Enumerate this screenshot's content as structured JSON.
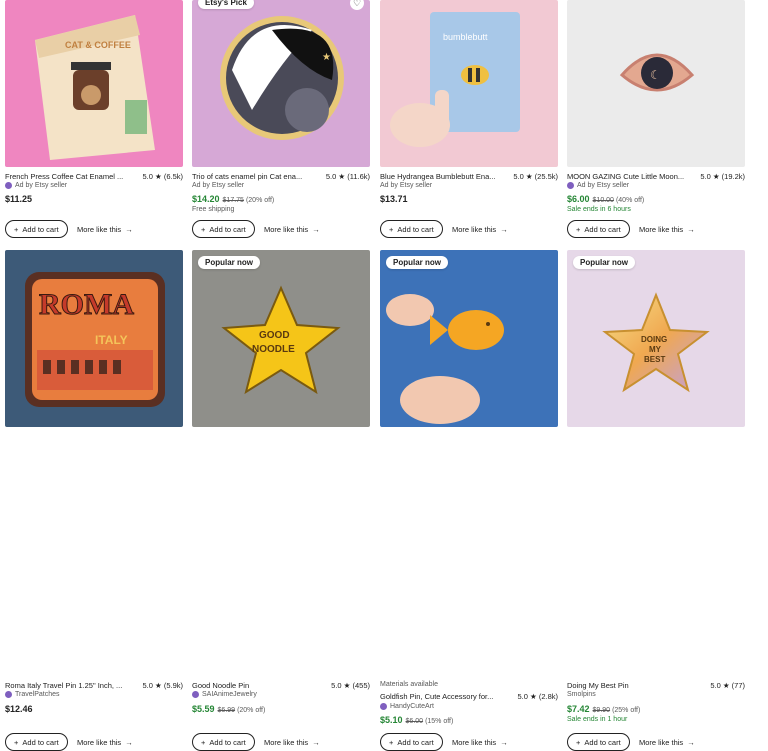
{
  "common": {
    "add_to_cart": "Add to cart",
    "more_like_this": "More like this",
    "plus_glyph": "+",
    "arrow_glyph": "→",
    "heart_glyph": "♡"
  },
  "items": [
    {
      "badge": "",
      "title": "French Press Coffee Cat Enamel ...",
      "rating": "5.0 ★ (6.5k)",
      "seller": "Ad by Etsy seller",
      "seller_badge": true,
      "price": "$11.25",
      "orig": "",
      "off": "",
      "sale": false,
      "extra": "",
      "image": "cat & coffee enamel pin on pink card",
      "img_text": "CAT & COFFEE"
    },
    {
      "badge": "Etsy's Pick",
      "title": "Trio of cats enamel pin Cat ena...",
      "rating": "5.0 ★ (11.6k)",
      "seller": "Ad by Etsy seller",
      "seller_badge": false,
      "price": "$14.20",
      "orig": "$17.75",
      "off": "(20% off)",
      "sale": true,
      "extra": "Free shipping",
      "image": "black and white cats enamel pin",
      "img_text": ""
    },
    {
      "badge": "",
      "title": "Blue Hydrangea Bumblebutt Ena...",
      "rating": "5.0 ★ (25.5k)",
      "seller": "Ad by Etsy seller",
      "seller_badge": false,
      "price": "$13.71",
      "orig": "",
      "off": "",
      "sale": false,
      "extra": "",
      "image": "bumblebee pin card held in hand",
      "img_text": "bumblebutt"
    },
    {
      "badge": "",
      "title": "MOON GAZING Cute Little Moon...",
      "rating": "5.0 ★ (19.2k)",
      "seller": "Ad by Etsy seller",
      "seller_badge": true,
      "price": "$6.00",
      "orig": "$10.00",
      "off": "(40% off)",
      "sale": true,
      "extra": "Sale ends in 6 hours",
      "image": "rose gold eye pin with moon",
      "img_text": ""
    },
    {
      "badge": "",
      "title": "Roma Italy Travel Pin 1.25\" Inch, ...",
      "rating": "5.0 ★ (5.9k)",
      "seller": "TravelPatches",
      "seller_badge": true,
      "price": "$12.46",
      "orig": "",
      "off": "",
      "sale": false,
      "extra": "",
      "image": "Roma Italy colosseum pin",
      "img_text": "ROMA",
      "img_text2": "ITALY"
    },
    {
      "badge": "Popular now",
      "title": "Good Noodle Pin",
      "rating": "5.0 ★ (455)",
      "seller": "SAIAnimeJewelry",
      "seller_badge": true,
      "price": "$5.59",
      "orig": "$6.99",
      "off": "(20% off)",
      "sale": true,
      "extra": "",
      "image": "yellow star pin good noodle",
      "img_text": "GOOD",
      "img_text2": "NOODLE"
    },
    {
      "badge": "Popular now",
      "title": "Goldfish Pin, Cute Accessory for...",
      "rating": "5.0 ★ (2.8k)",
      "seller": "HandyCuteArt",
      "seller_badge": true,
      "price": "$5.10",
      "orig": "$6.00",
      "off": "(15% off)",
      "sale": true,
      "extra": "Materials available",
      "image": "goldfish cracker pin held in fingers",
      "img_text": ""
    },
    {
      "badge": "Popular now",
      "title": "Doing My Best Pin",
      "rating": "5.0 ★ (77)",
      "seller": "Smolpins",
      "seller_badge": false,
      "price": "$7.42",
      "orig": "$9.90",
      "off": "(25% off)",
      "sale": true,
      "extra": "Sale ends in 1 hour",
      "image": "gold star pin doing my best",
      "img_text": "DOING",
      "img_text2": "MY",
      "img_text3": "BEST"
    }
  ],
  "colors": {
    "sale_green": "#258635",
    "muted": "#595959",
    "text": "#222222"
  }
}
